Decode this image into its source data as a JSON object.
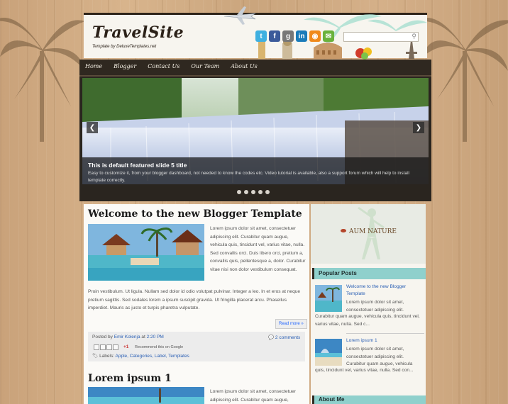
{
  "header": {
    "site_title": "TravelSite",
    "tagline": "Template by DeluxeTemplates.net",
    "search_icon": "search-icon"
  },
  "socials": [
    {
      "name": "twitter",
      "glyph": "t",
      "color": "#3fb0e0"
    },
    {
      "name": "facebook",
      "glyph": "f",
      "color": "#3b5a9a"
    },
    {
      "name": "google",
      "glyph": "g",
      "color": "#777777"
    },
    {
      "name": "linkedin",
      "glyph": "in",
      "color": "#1a7bb9"
    },
    {
      "name": "rss",
      "glyph": "◉",
      "color": "#f08a1c"
    },
    {
      "name": "email",
      "glyph": "✉",
      "color": "#6ab23c"
    }
  ],
  "nav": {
    "items": [
      "Home",
      "Blogger",
      "Contact Us",
      "Our Team",
      "About Us"
    ]
  },
  "slider": {
    "title": "This is default featured slide 5 title",
    "text": "Easy to customize it, from your blogger dashboard, not needed to know the codes etc. Video tutorial is available, also a support forum which will help to install template correctly.",
    "prev": "❮",
    "next": "❯",
    "slide_count": 5
  },
  "post1": {
    "title": "Welcome to the new Blogger Template",
    "text_right": "Lorem ipsum dolor sit amet, consectetuer adipiscing elit. Curabitur quam augue, vehicula quis, tincidunt vel, varius vitae, nulla. Sed convallis orci. Duis libero orci, pretium a, convallis quis, pellentesque a, dolor. Curabitur vitae nisi non dolor vestibulum consequat.",
    "text_below": "Proin vestibulum. Ut ligula. Nullam sed dolor id odio volutpat pulvinar. Integer a leo. In et eros at neque pretium sagittis. Sed sodales lorem a ipsum suscipit gravida. Ut fringilla placerat arcu. Phasellus imperdiet. Mauris ac justo et turpis pharetra vulputate.",
    "read_more": "Read more »",
    "posted_by_label": "Posted by",
    "author": "Emir Kolenja",
    "at_label": "at",
    "time": "2:20 PM",
    "comments": "2 comments",
    "gplus": "+1",
    "recommend": "Recommend this on Google",
    "labels_label": "Labels:",
    "labels": "Apple, Categories, Label, Templates"
  },
  "post2": {
    "title": "Lorem ipsum 1",
    "text_right": "Lorem ipsum dolor sit amet, consectetuer adipiscing elit. Curabitur quam augue,"
  },
  "sidebar": {
    "ad_text": "AUM NATURE",
    "popular_heading": "Popular Posts",
    "popular": [
      {
        "title": "Welcome to the new Blogger Template",
        "text": "Lorem ipsum dolor sit amet, consectetuer adipiscing elit.",
        "text_cont": "Curabitur quam augue, vehicula quis, tincidunt vel, varius vitae, nulla. Sed c..."
      },
      {
        "title": "Lorem ipsum 1",
        "text": "Lorem ipsum dolor sit amet, consectetuer adipiscing elit. Curabitur quam augue, vehicula",
        "text_cont": "quis, tincidunt vel, varius vitae, nulla. Sed con..."
      }
    ],
    "about_heading": "About Me"
  }
}
